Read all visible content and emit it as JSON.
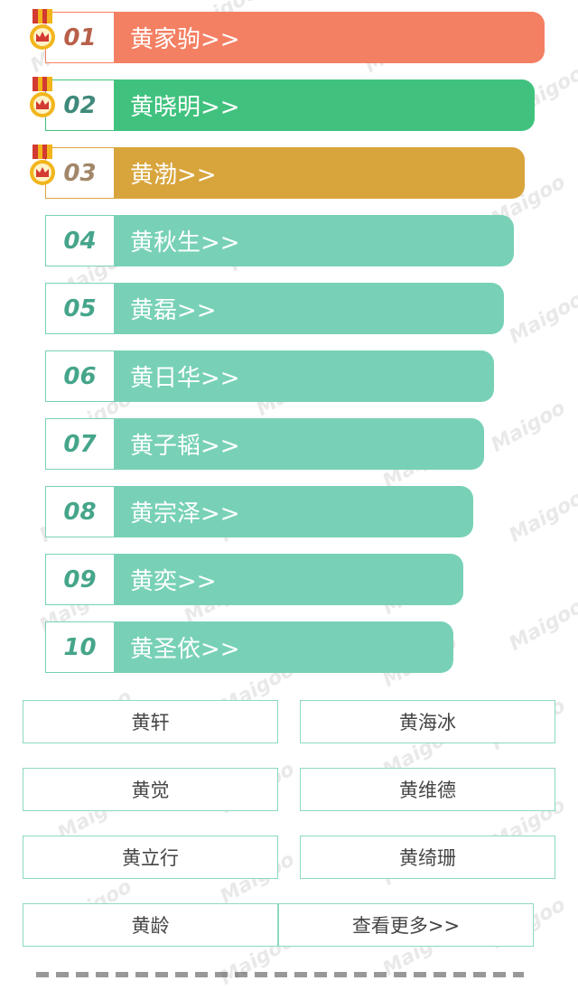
{
  "colors": {
    "rank1": "#f48063",
    "rank2": "#40c27e",
    "rank3": "#d8a53c",
    "default": "#78d1b7",
    "num1": "#b8604a",
    "num2": "#3f8a7a",
    "num3": "#a2876a",
    "numDefault": "#45a58a",
    "medal_ribbon": "#d23a32",
    "medal_gold": "#f2b51c"
  },
  "watermark": "Maigoo",
  "ranks": [
    {
      "num": "01",
      "label": "黄家驹>>"
    },
    {
      "num": "02",
      "label": "黄晓明>>"
    },
    {
      "num": "03",
      "label": "黄渤>>"
    },
    {
      "num": "04",
      "label": "黄秋生>>"
    },
    {
      "num": "05",
      "label": "黄磊>>"
    },
    {
      "num": "06",
      "label": "黄日华>>"
    },
    {
      "num": "07",
      "label": "黄子韬>>"
    },
    {
      "num": "08",
      "label": "黄宗泽>>"
    },
    {
      "num": "09",
      "label": "黄奕>>"
    },
    {
      "num": "10",
      "label": "黄圣依>>"
    }
  ],
  "grid": [
    {
      "label": "黄轩"
    },
    {
      "label": "黄海冰"
    },
    {
      "label": "黄觉"
    },
    {
      "label": "黄维德"
    },
    {
      "label": "黄立行"
    },
    {
      "label": "黄绮珊"
    },
    {
      "label": "黄龄"
    },
    {
      "label": "查看更多>>"
    }
  ]
}
